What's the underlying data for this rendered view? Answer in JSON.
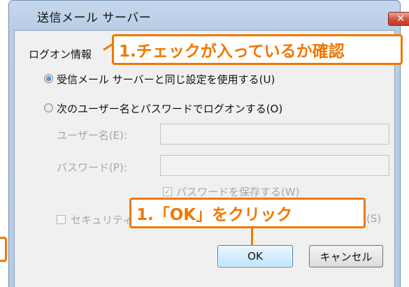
{
  "dialog": {
    "title": "送信メール サーバー",
    "close_label": "✕",
    "group_label": "ログオン情報",
    "radio_same": "受信メール サーバーと同じ設定を使用する(U)",
    "radio_other": "次のユーザー名とパスワードでログオンする(O)",
    "username_label": "ユーザー名(E):",
    "username_value": "",
    "password_label": "パスワード(P):",
    "password_value": "",
    "save_password_label": "パスワードを保存する(W)",
    "secure_auth_label": "セキュリティ",
    "secure_auth_suffix": "(S)",
    "ok_label": "OK",
    "cancel_label": "キャンセル"
  },
  "annotations": {
    "check_note": "1.チェックが入っているか確認",
    "click_note": "1.「OK」をクリック"
  }
}
